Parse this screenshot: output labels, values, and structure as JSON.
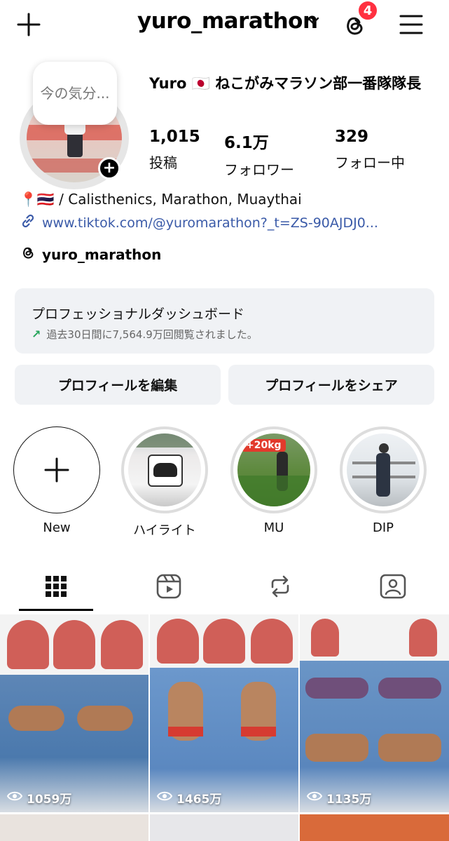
{
  "header": {
    "username": "yuro_marathon",
    "threads_badge_count": "4"
  },
  "profile": {
    "note": "今の気分...",
    "display_name": "Yuro 🇯🇵 ねこがみマラソン部一番隊隊長",
    "stats": [
      {
        "value": "1,015",
        "label": "投稿"
      },
      {
        "value": "6.1万",
        "label": "フォロワー"
      },
      {
        "value": "329",
        "label": "フォロー中"
      }
    ],
    "bio": "📍🇹🇭 / Calisthenics, Marathon, Muaythai",
    "link": "www.tiktok.com/@yuromarathon?_t=ZS-90AJDJ0...",
    "threads_handle": "yuro_marathon"
  },
  "dashboard": {
    "title": "プロフェッショナルダッシュボード",
    "subtitle": "過去30日間に7,564.9万回閲覧されました。"
  },
  "actions": {
    "edit_label": "プロフィールを編集",
    "share_label": "プロフィールをシェア"
  },
  "highlights": [
    {
      "label": "New"
    },
    {
      "label": "ハイライト"
    },
    {
      "label": "MU",
      "overlay": "+20kg"
    },
    {
      "label": "DIP"
    }
  ],
  "grid": [
    {
      "views": "1059万"
    },
    {
      "views": "1465万"
    },
    {
      "views": "1135万"
    }
  ],
  "colors": {
    "badge": "#ff3040",
    "link": "#3a5aa8",
    "trend": "#24a45a",
    "button_bg": "#f0f2f5"
  }
}
